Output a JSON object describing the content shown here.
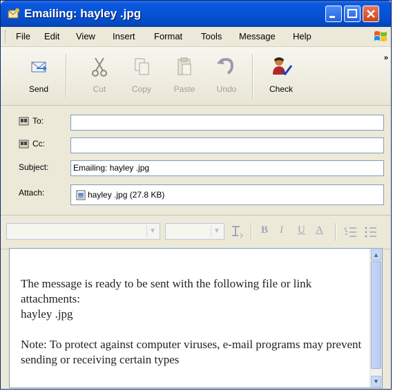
{
  "window": {
    "title": "Emailing: hayley .jpg"
  },
  "menu": [
    "File",
    "Edit",
    "View",
    "Insert",
    "Format",
    "Tools",
    "Message",
    "Help"
  ],
  "toolbar": {
    "send": "Send",
    "cut": "Cut",
    "copy": "Copy",
    "paste": "Paste",
    "undo": "Undo",
    "check": "Check",
    "more": "»"
  },
  "headers": {
    "to_label": "To:",
    "to_value": "",
    "cc_label": "Cc:",
    "cc_value": "",
    "subject_label": "Subject:",
    "subject_value": "Emailing: hayley .jpg",
    "attach_label": "Attach:",
    "attach_value": "hayley .jpg (27.8 KB)"
  },
  "format_bar": {
    "bold": "B",
    "italic": "I",
    "underline": "U",
    "font_color": "A"
  },
  "message": {
    "line1": "The message is ready to be sent with the following file or link attachments:",
    "line2": "hayley .jpg",
    "line3": "Note: To protect against computer viruses, e-mail programs may prevent sending or receiving certain types"
  },
  "colors": {
    "titlebar": "#0653d6",
    "chrome": "#ece9d8",
    "field_border": "#7f9db9"
  }
}
